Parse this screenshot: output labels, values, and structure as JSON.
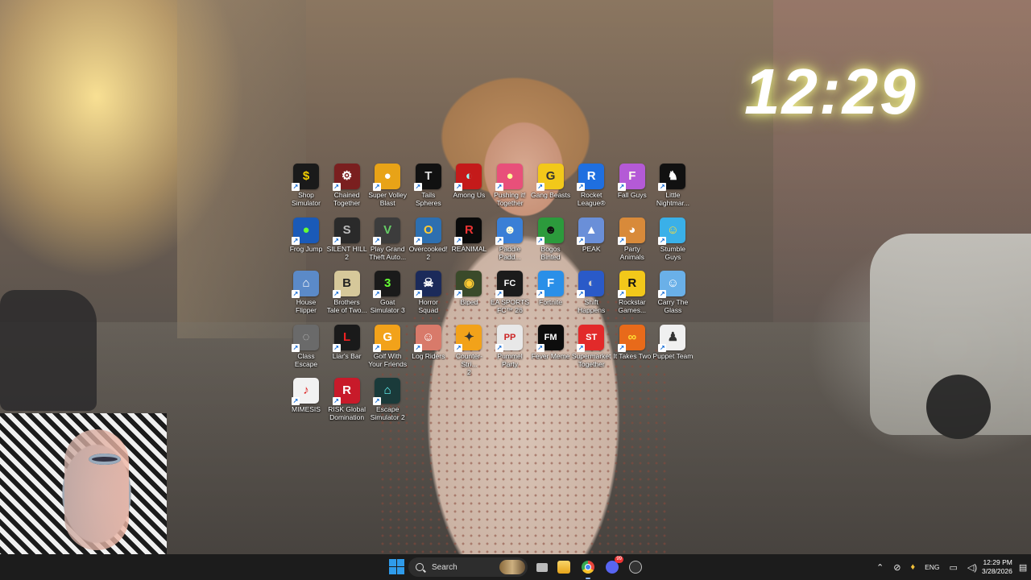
{
  "clock": {
    "time": "12:29"
  },
  "desktop_icons": [
    {
      "label": "Shop\nSimulator",
      "color": "#1a1a1a",
      "glyph": "$",
      "fg": "#f5d000",
      "col": 0,
      "row": 0
    },
    {
      "label": "Chained\nTogether",
      "color": "#7a1f1f",
      "glyph": "⚙",
      "fg": "#fff",
      "col": 1,
      "row": 0
    },
    {
      "label": "Super Volley\nBlast",
      "color": "#e8a317",
      "glyph": "●",
      "fg": "#fff",
      "col": 2,
      "row": 0
    },
    {
      "label": "Tails\nSpheres",
      "color": "#111",
      "glyph": "T",
      "fg": "#ddd",
      "col": 3,
      "row": 0
    },
    {
      "label": "Among Us",
      "color": "#c41a1a",
      "glyph": "◐",
      "fg": "#9ff",
      "col": 4,
      "row": 0
    },
    {
      "label": "Pushing it!\nTogether",
      "color": "#e8507a",
      "glyph": "●",
      "fg": "#ff9",
      "col": 5,
      "row": 0
    },
    {
      "label": "Gang Beasts",
      "color": "#f2c81a",
      "glyph": "G",
      "fg": "#333",
      "col": 6,
      "row": 0
    },
    {
      "label": "Rocket\nLeague®",
      "color": "#1f6fe0",
      "glyph": "R",
      "fg": "#fff",
      "col": 7,
      "row": 0
    },
    {
      "label": "Fall Guys",
      "color": "#b45ad6",
      "glyph": "F",
      "fg": "#ffe",
      "col": 8,
      "row": 0
    },
    {
      "label": "Little\nNightmar...",
      "color": "#111",
      "glyph": "♞",
      "fg": "#fff",
      "col": 9,
      "row": 0
    },
    {
      "label": "Frog Jump",
      "color": "#1a5ab8",
      "glyph": "●",
      "fg": "#6f3",
      "col": 0,
      "row": 1
    },
    {
      "label": "SILENT HILL\n2",
      "color": "#2a2a2a",
      "glyph": "S",
      "fg": "#bbb",
      "col": 1,
      "row": 1
    },
    {
      "label": "Play Grand\nTheft Auto...",
      "color": "#3c3c3c",
      "glyph": "V",
      "fg": "#6c6",
      "col": 2,
      "row": 1
    },
    {
      "label": "Overcooked!\n2",
      "color": "#2d6fb0",
      "glyph": "O",
      "fg": "#fc3",
      "col": 3,
      "row": 1
    },
    {
      "label": "REANIMAL",
      "color": "#0a0a0a",
      "glyph": "R",
      "fg": "#e33",
      "col": 4,
      "row": 1
    },
    {
      "label": "Paddle\nPadd...",
      "color": "#3a7fd6",
      "glyph": "☻",
      "fg": "#ffd",
      "col": 5,
      "row": 1
    },
    {
      "label": "Bogos Binted",
      "color": "#2c9a3c",
      "glyph": "☻",
      "fg": "#111",
      "col": 6,
      "row": 1
    },
    {
      "label": "PEAK",
      "color": "#6a8fd8",
      "glyph": "▲",
      "fg": "#fff",
      "col": 7,
      "row": 1
    },
    {
      "label": "Party\nAnimals",
      "color": "#d88a3a",
      "glyph": "◕",
      "fg": "#fff",
      "col": 8,
      "row": 1
    },
    {
      "label": "Stumble\nGuys",
      "color": "#3ab0e8",
      "glyph": "☺",
      "fg": "#fd3",
      "col": 9,
      "row": 1
    },
    {
      "label": "House\nFlipper",
      "color": "#5b8ac8",
      "glyph": "⌂",
      "fg": "#fff",
      "col": 0,
      "row": 2
    },
    {
      "label": "Brothers\nTale of Two...",
      "color": "#d6c89a",
      "glyph": "B",
      "fg": "#222",
      "col": 1,
      "row": 2
    },
    {
      "label": "Goat\nSimulator 3",
      "color": "#1a1a1a",
      "glyph": "3",
      "fg": "#6f3",
      "col": 2,
      "row": 2
    },
    {
      "label": "Horror Squad",
      "color": "#1b2a5a",
      "glyph": "☠",
      "fg": "#fff",
      "col": 3,
      "row": 2
    },
    {
      "label": "Biped",
      "color": "#3a4a2a",
      "glyph": "◉",
      "fg": "#fc3",
      "col": 4,
      "row": 2
    },
    {
      "label": "EA SPORTS\nFC™ 26",
      "color": "#1b1b1b",
      "glyph": "FC",
      "fg": "#fff",
      "col": 5,
      "row": 2
    },
    {
      "label": "Fortnite",
      "color": "#2a8fe8",
      "glyph": "F",
      "fg": "#fff",
      "col": 6,
      "row": 2
    },
    {
      "label": "Shift\nHappens",
      "color": "#2a5ac8",
      "glyph": "◐",
      "fg": "#ccc",
      "col": 7,
      "row": 2
    },
    {
      "label": "Rockstar\nGames...",
      "color": "#f2c81a",
      "glyph": "R",
      "fg": "#111",
      "col": 8,
      "row": 2
    },
    {
      "label": "Carry The\nGlass",
      "color": "#6ab0e8",
      "glyph": "☺",
      "fg": "#fff",
      "col": 9,
      "row": 2
    },
    {
      "label": "Class Escape",
      "color": "#6a6a6a",
      "glyph": "◌",
      "fg": "#ccc",
      "col": 0,
      "row": 3
    },
    {
      "label": "Liar's Bar",
      "color": "#1a1a1a",
      "glyph": "L",
      "fg": "#e22",
      "col": 1,
      "row": 3
    },
    {
      "label": "Golf With\nYour Friends",
      "color": "#f2a21a",
      "glyph": "G",
      "fg": "#fff",
      "col": 2,
      "row": 3
    },
    {
      "label": "Log Riders",
      "color": "#d87a6a",
      "glyph": "☺",
      "fg": "#fff",
      "col": 3,
      "row": 3
    },
    {
      "label": "Counter-Stri...\n2",
      "color": "#f2a21a",
      "glyph": "✦",
      "fg": "#333",
      "col": 4,
      "row": 3
    },
    {
      "label": "Pummel\nParty",
      "color": "#e8e8e8",
      "glyph": "PP",
      "fg": "#c22",
      "col": 5,
      "row": 3
    },
    {
      "label": "Fever Meme",
      "color": "#0d0d0d",
      "glyph": "FM",
      "fg": "#fff",
      "col": 6,
      "row": 3
    },
    {
      "label": "Supermarket\nTogether",
      "color": "#e22a2a",
      "glyph": "ST",
      "fg": "#fff",
      "col": 7,
      "row": 3
    },
    {
      "label": "It Takes Two",
      "color": "#e86a1a",
      "glyph": "∞",
      "fg": "#fd3",
      "col": 8,
      "row": 3
    },
    {
      "label": "Puppet Team",
      "color": "#f0f0f0",
      "glyph": "♟",
      "fg": "#333",
      "col": 9,
      "row": 3
    },
    {
      "label": "MIMESIS",
      "color": "#f2f2f2",
      "glyph": "♪",
      "fg": "#d22",
      "col": 0,
      "row": 4
    },
    {
      "label": "RISK Global\nDomination",
      "color": "#c81a2a",
      "glyph": "R",
      "fg": "#fff",
      "col": 1,
      "row": 4
    },
    {
      "label": "Escape\nSimulator 2",
      "color": "#1a3a3a",
      "glyph": "⌂",
      "fg": "#6ff",
      "col": 2,
      "row": 4
    }
  ],
  "taskbar": {
    "search_placeholder": "Search",
    "apps": [
      {
        "name": "task-view",
        "color": "#bbbbbb"
      },
      {
        "name": "file-explorer",
        "color": "#f2c13a"
      },
      {
        "name": "chrome",
        "color": "#e8453c"
      },
      {
        "name": "discord",
        "color": "#5865f2",
        "badge": "99"
      },
      {
        "name": "steam-helper",
        "color": "#444444"
      }
    ],
    "tray": {
      "language": "ENG",
      "time": "12:29 PM",
      "date": "3/28/2026"
    }
  }
}
